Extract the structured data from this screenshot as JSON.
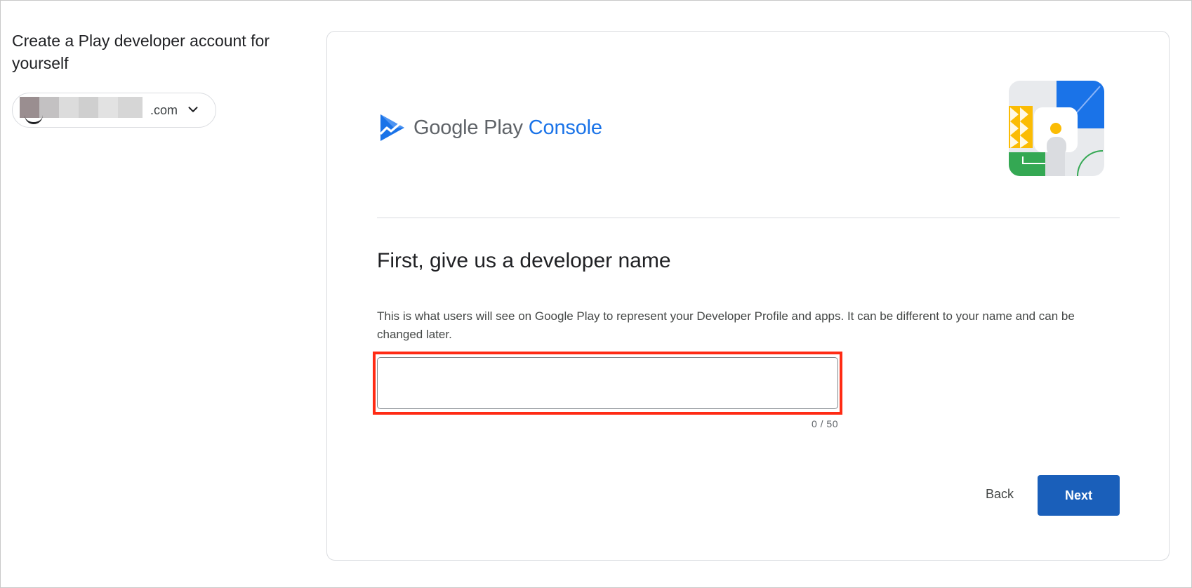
{
  "sidebar": {
    "title": "Create a Play developer account for yourself",
    "account": {
      "email_suffix": ".com",
      "dropdown_icon": "chevron-down-icon"
    }
  },
  "brand": {
    "google_play": "Google Play",
    "console": "Console",
    "logo_icon": "play-console-logo-icon",
    "illustration_icon": "play-console-illustration"
  },
  "form": {
    "heading": "First, give us a developer name",
    "description": "This is what users will see on Google Play to represent your Developer Profile and apps. It can be different to your name and can be changed later.",
    "developer_name_value": "",
    "counter": "0 / 50"
  },
  "actions": {
    "back_label": "Back",
    "next_label": "Next"
  },
  "colors": {
    "primary": "#1a5fba",
    "console_blue": "#1a73e8",
    "highlight": "#ff2b14"
  }
}
